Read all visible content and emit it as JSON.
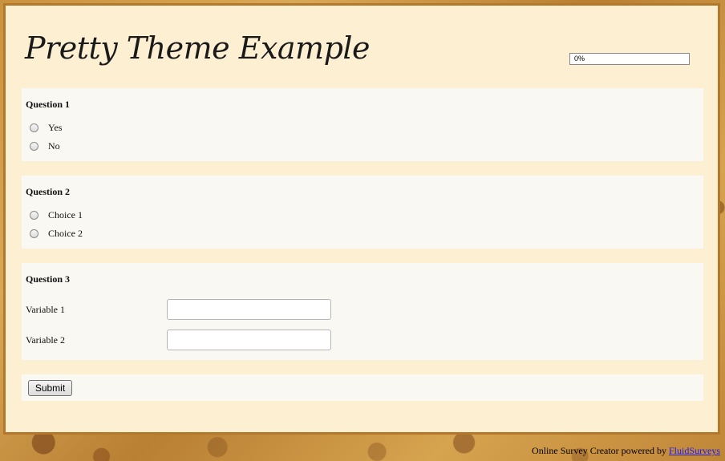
{
  "survey": {
    "title": "Pretty Theme Example",
    "progress": {
      "value": 0,
      "label": "0%"
    }
  },
  "questions": [
    {
      "title": "Question 1",
      "options": [
        "Yes",
        "No"
      ]
    },
    {
      "title": "Question 2",
      "options": [
        "Choice 1",
        "Choice 2"
      ]
    },
    {
      "title": "Question 3",
      "fields": [
        {
          "label": "Variable 1",
          "value": ""
        },
        {
          "label": "Variable 2",
          "value": ""
        }
      ]
    }
  ],
  "actions": {
    "submit_label": "Submit"
  },
  "footer": {
    "text": "Online Survey Creator powered by",
    "link_label": "FluidSurveys"
  },
  "colors": {
    "panel_bg": "#fdefd2",
    "panel_border": "#b4782c",
    "block_bg": "#f9f8f3",
    "link": "#1a1aee"
  }
}
